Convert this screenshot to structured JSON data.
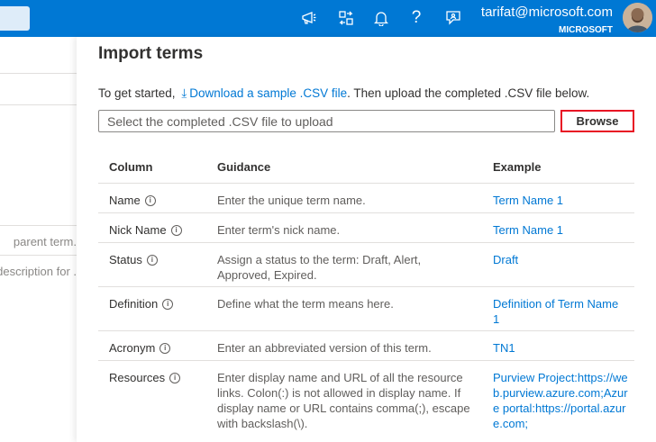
{
  "header": {
    "email": "tarifat@microsoft.com",
    "org": "MICROSOFT",
    "icons": [
      "megaphone-icon",
      "directory-switch-icon",
      "bell-icon",
      "help-icon",
      "feedback-icon"
    ]
  },
  "leftpane": {
    "clipped_1": "parent term.",
    "clipped_2": "description for ."
  },
  "panel": {
    "title": "Import terms",
    "intro_before": "To get started,",
    "download_link": "Download a sample .CSV file",
    "intro_after": ". Then upload the completed .CSV file below.",
    "file_placeholder": "Select the completed .CSV file to upload",
    "browse_label": "Browse"
  },
  "table": {
    "headers": {
      "column": "Column",
      "guidance": "Guidance",
      "example": "Example"
    },
    "rows": [
      {
        "name": "Name",
        "guidance": "Enter the unique term name.",
        "example": "Term Name 1"
      },
      {
        "name": "Nick Name",
        "guidance": "Enter term's nick name.",
        "example": "Term Name 1"
      },
      {
        "name": "Status",
        "guidance": "Assign a status to the term: Draft, Alert, Approved, Expired.",
        "example": "Draft"
      },
      {
        "name": "Definition",
        "guidance": "Define what the term means here.",
        "example": "Definition of Term Name 1"
      },
      {
        "name": "Acronym",
        "guidance": "Enter an abbreviated version of this term.",
        "example": "TN1"
      },
      {
        "name": "Resources",
        "guidance": "Enter display name and URL of all the resource links. Colon(:) is not allowed in display name. If display name or URL contains comma(;), escape with backslash(\\).",
        "example": "Purview Project:https://web.purview.azure.com;Azure portal:https://portal.azure.com;"
      }
    ]
  }
}
